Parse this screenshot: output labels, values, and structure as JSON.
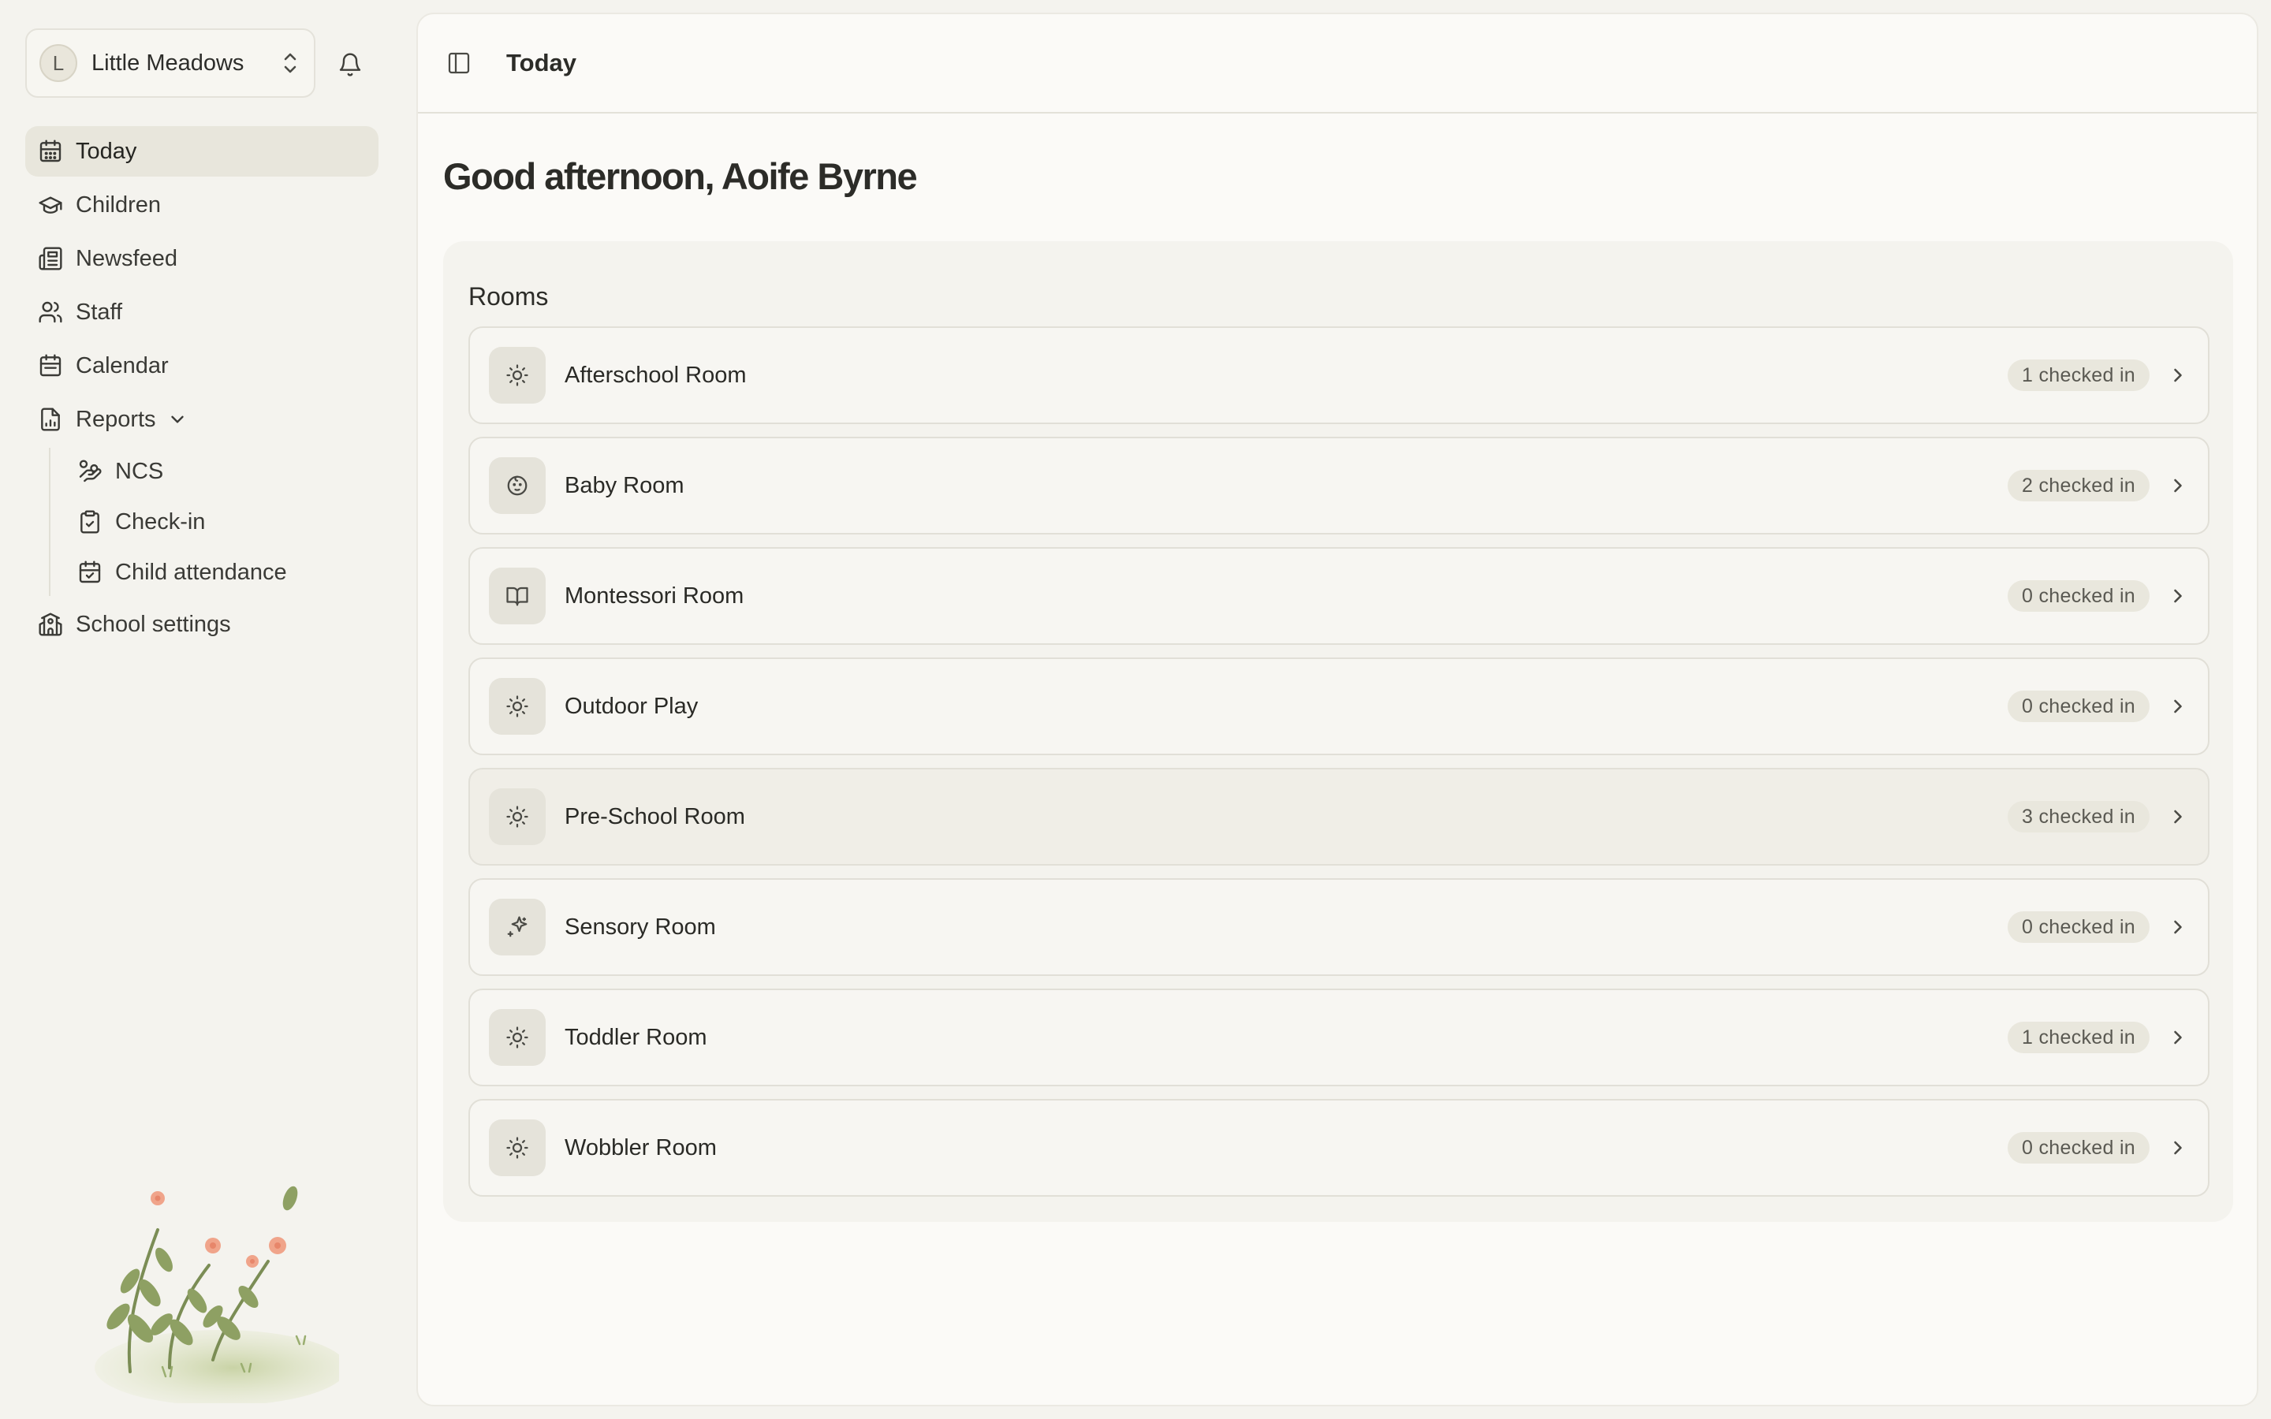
{
  "school_switcher": {
    "avatar_initial": "L",
    "school_name": "Little Meadows"
  },
  "nav": {
    "items": [
      {
        "label": "Today",
        "icon": "calendar-days-icon",
        "active": true
      },
      {
        "label": "Children",
        "icon": "graduation-cap-icon"
      },
      {
        "label": "Newsfeed",
        "icon": "newspaper-icon"
      },
      {
        "label": "Staff",
        "icon": "users-icon"
      },
      {
        "label": "Calendar",
        "icon": "calendar-icon"
      },
      {
        "label": "Reports",
        "icon": "file-chart-icon",
        "expanded": true
      }
    ],
    "report_items": [
      {
        "label": "NCS",
        "icon": "hand-coins-icon"
      },
      {
        "label": "Check-in",
        "icon": "clipboard-check-icon"
      },
      {
        "label": "Child attendance",
        "icon": "calendar-check-icon"
      }
    ],
    "settings": {
      "label": "School settings",
      "icon": "school-icon"
    }
  },
  "header": {
    "title": "Today"
  },
  "greeting": "Good afternoon, Aoife Byrne",
  "rooms": {
    "title": "Rooms",
    "items": [
      {
        "name": "Afterschool Room",
        "status": "1 checked in",
        "icon": "sun-icon"
      },
      {
        "name": "Baby Room",
        "status": "2 checked in",
        "icon": "baby-icon"
      },
      {
        "name": "Montessori Room",
        "status": "0 checked in",
        "icon": "book-open-icon"
      },
      {
        "name": "Outdoor Play",
        "status": "0 checked in",
        "icon": "sun-icon"
      },
      {
        "name": "Pre-School Room",
        "status": "3 checked in",
        "icon": "sun-icon"
      },
      {
        "name": "Sensory Room",
        "status": "0 checked in",
        "icon": "sparkles-icon"
      },
      {
        "name": "Toddler Room",
        "status": "1 checked in",
        "icon": "sun-icon"
      },
      {
        "name": "Wobbler Room",
        "status": "0 checked in",
        "icon": "sun-icon"
      }
    ]
  },
  "colors": {
    "background": "#f4f3ee",
    "panel": "#fbfaf7",
    "active_nav": "#e8e6dc",
    "badge": "#e9e7dd",
    "text": "#2c2c28"
  }
}
